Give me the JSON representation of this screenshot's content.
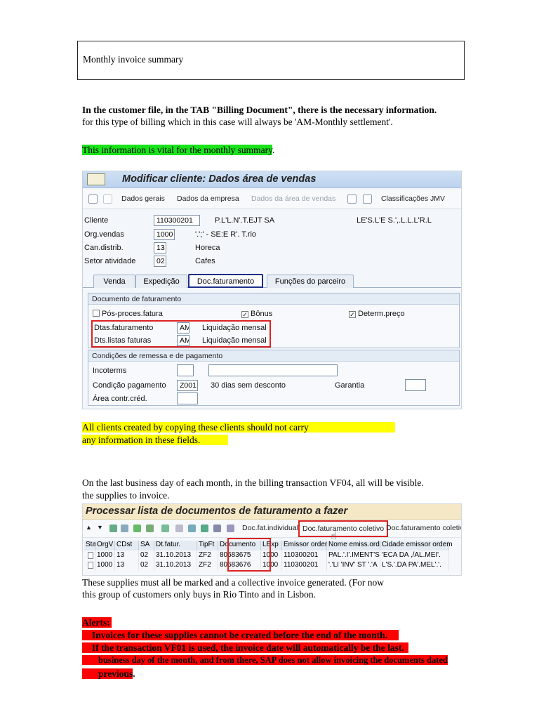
{
  "doc": {
    "title_box": "Monthly invoice summary",
    "intro_bold": "In the customer file, in the TAB \"Billing Document\", there is the necessary information.",
    "intro_plain": "for this type of billing which in this case will always be 'AM-Monthly settlement'.",
    "green_note": "This information is vital for the monthly summary",
    "green_note_tail": ".",
    "yellow_line1": "All clients created by copying these clients should not carry",
    "yellow_line2": "any information in these fields.",
    "vf04_line1": "On the last business day of each month, in the billing transaction VF04, all will be visible.",
    "vf04_line2": "the supplies to invoice.",
    "marked_line1": "These supplies must all be marked and a collective invoice generated. (For now",
    "marked_line2": "this group of customers only buys in Rio Tinto and in Lisbon.",
    "alerts_title": "Alerts:",
    "alert1": " Invoices for these supplies cannot be created before the end of the month.",
    "alert2": " If the transaction VF01 is used, the invoice date will automatically be the last.",
    "alert2_cont1": "business day of the month, and from there, SAP does not allow invoicing the documents dated",
    "alert2_cont2": "previous",
    "alert2_cont2_tail": "."
  },
  "sap1": {
    "title": "Modificar cliente: Dados área de vendas",
    "toolbar": [
      "Dados gerais",
      "Dados da empresa",
      "Dados da área de vendas",
      "Classificações JMV"
    ],
    "fields": {
      "cliente_label": "Cliente",
      "cliente_value": "110300201",
      "cliente_name": "P.L'L.N'.T.EJT SA",
      "cliente_extra": "LE'S.L'E S.',.L.L.L'R.L",
      "org_label": "Org.vendas",
      "org_value": "1000",
      "org_name": "'.';' - SE:E R'. T.rio",
      "can_label": "Can.distrib.",
      "can_value": "13",
      "can_name": "Horeca",
      "setor_label": "Setor atividade",
      "setor_value": "02",
      "setor_name": "Cafes"
    },
    "tabs": [
      "Venda",
      "Expedição",
      "Doc.faturamento",
      "Funções do parceiro"
    ],
    "group1": {
      "header": "Documento de faturamento",
      "chk_pos": "Pós-proces.fatura",
      "chk_bonus": "Bônus",
      "chk_determ": "Determ.preço",
      "dtas_label": "Dtas.faturamento",
      "dtas_value": "AM",
      "dtas_text": "Liquidação mensal",
      "dts_label": "Dts.listas faturas",
      "dts_value": "AM",
      "dts_text": "Liquidação mensal"
    },
    "group2": {
      "header": "Condições de remessa e de pagamento",
      "incoterms_label": "Incoterms",
      "cond_label": "Condição pagamento",
      "cond_value": "Z001",
      "cond_text": "30 dias sem desconto",
      "garantia_label": "Garantia",
      "area_label": "Área contr.créd."
    }
  },
  "sap2": {
    "title": "Processar lista de documentos de faturamento a fazer",
    "toolbar": [
      "Doc.fat.individual",
      "Doc.faturamento coletivo",
      "Doc.faturamento coletivo/"
    ],
    "columns": [
      "Sta",
      "OrgV",
      "CDst",
      "SA",
      "Dt.fatur.",
      "TipFt",
      "Documento",
      "LExp",
      "Emissor ordem",
      "Nome emiss.ord.",
      "Cidade emissor ordem"
    ],
    "rows": [
      [
        "",
        "1000",
        "13",
        "02",
        "31.10.2013",
        "ZF2",
        "80683675",
        "1000",
        "110300201",
        "PAL.'.I'.IMENT'S.N",
        "'ECA DA ,/AL.MEI'."
      ],
      [
        "",
        "1000",
        "13",
        "02",
        "31.10.2013",
        "ZF2",
        "80683676",
        "1000",
        "110300201",
        "'.'LI 'INV' ST '.'A",
        "L'S.'.DA PA'.MEL'.'."
      ]
    ]
  }
}
